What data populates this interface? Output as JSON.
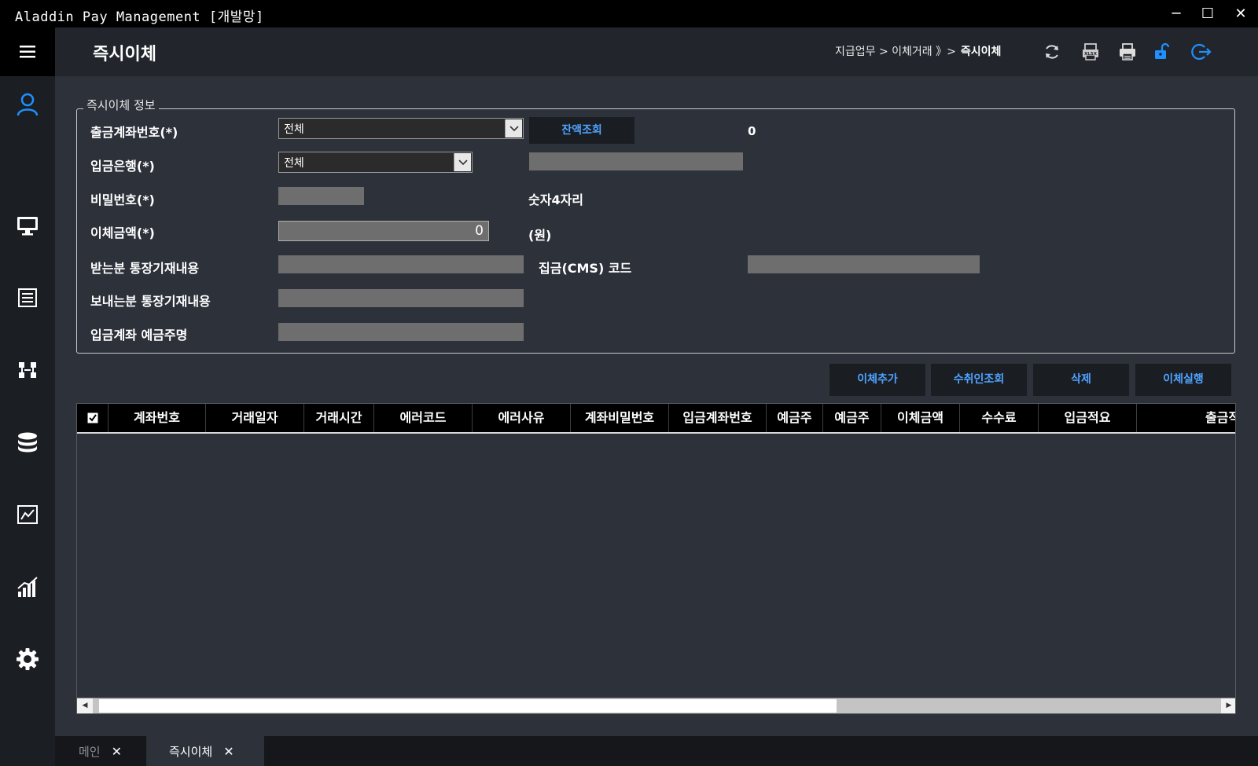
{
  "window": {
    "title": "Aladdin Pay Management [개발망]",
    "minimize_icon": "minimize-icon",
    "maximize_icon": "maximize-icon",
    "close_icon": "close-icon",
    "minimize_glyph": "─",
    "maximize_glyph": "☐",
    "close_glyph": "✕"
  },
  "sidebar": {
    "items": [
      {
        "icon": "user-icon"
      },
      {
        "icon": "monitor-icon"
      },
      {
        "icon": "list-icon"
      },
      {
        "icon": "transfer-icon"
      },
      {
        "icon": "database-icon"
      },
      {
        "icon": "line-chart-icon"
      },
      {
        "icon": "bar-chart-icon"
      },
      {
        "icon": "gear-icon"
      }
    ],
    "accent": "#1e90ff"
  },
  "header": {
    "title": "즉시이체",
    "breadcrumb": {
      "path": "지급업무 > 이체거래 》>",
      "current": "즉시이체"
    },
    "icons": [
      "refresh-icon",
      "excel-icon",
      "print-icon",
      "unlock-icon",
      "logout-icon"
    ]
  },
  "form": {
    "legend": "즉시이체 정보",
    "withdraw_account": {
      "label": "출금계좌번호(*)",
      "value": "전체"
    },
    "balance_button": "잔액조회",
    "balance_value": "0",
    "deposit_bank": {
      "label": "입금은행(*)",
      "value": "전체"
    },
    "password": {
      "label": "비밀번호(*)",
      "hint": "숫자4자리"
    },
    "amount": {
      "label": "이체금액(*)",
      "value": "0",
      "unit": "(원)"
    },
    "receiver_memo": {
      "label": "받는분 통장기재내용"
    },
    "cms_code": {
      "label": "집금(CMS) 코드"
    },
    "sender_memo": {
      "label": "보내는분 통장기재내용"
    },
    "depositor_name": {
      "label": "입금계좌 예금주명"
    }
  },
  "actions": {
    "add": "이체추가",
    "recipient_lookup": "수취인조회",
    "delete": "삭제",
    "execute": "이체실행"
  },
  "grid": {
    "columns": [
      "계좌번호",
      "거래일자",
      "거래시간",
      "에러코드",
      "에러사유",
      "계좌비밀번호",
      "입금계좌번호",
      "예금주",
      "예금주",
      "이체금액",
      "수수료",
      "입금적요",
      "출금적"
    ],
    "rows": []
  },
  "tabs": [
    {
      "label": "메인",
      "active": false
    },
    {
      "label": "즉시이체",
      "active": true
    }
  ],
  "tab_close_glyph": "✕"
}
